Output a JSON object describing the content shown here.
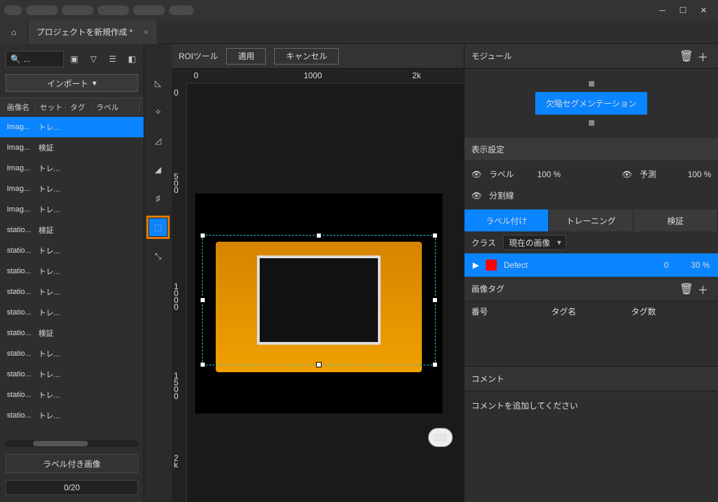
{
  "titlebar": {
    "tab_label": "プロジェクトを新規作成 *"
  },
  "left": {
    "search_placeholder": "...",
    "import_label": "インポート",
    "columns": {
      "c1": "画像名",
      "c2": "セット",
      "c3": "タグ",
      "c4": "ラベル"
    },
    "rows": [
      {
        "name": "Imag...",
        "set": "トレ...",
        "sel": true
      },
      {
        "name": "Imag...",
        "set": "検証"
      },
      {
        "name": "Imag...",
        "set": "トレ..."
      },
      {
        "name": "Imag...",
        "set": "トレ..."
      },
      {
        "name": "Imag...",
        "set": "トレ..."
      },
      {
        "name": "statio...",
        "set": "検証"
      },
      {
        "name": "statio...",
        "set": "トレ..."
      },
      {
        "name": "statio...",
        "set": "トレ..."
      },
      {
        "name": "statio...",
        "set": "トレ..."
      },
      {
        "name": "statio...",
        "set": "トレ..."
      },
      {
        "name": "statio...",
        "set": "検証"
      },
      {
        "name": "statio...",
        "set": "トレ..."
      },
      {
        "name": "statio...",
        "set": "トレ..."
      },
      {
        "name": "statio...",
        "set": "トレ..."
      },
      {
        "name": "statio...",
        "set": "トレ..."
      }
    ],
    "labeled_images": "ラベル付き画像",
    "progress": "0/20"
  },
  "canvas": {
    "roi_title": "ROIツール",
    "apply": "適用",
    "cancel": "キャンセル",
    "ruler_h": {
      "0": "0",
      "1000": "1000",
      "2k": "2k"
    },
    "ruler_v": {
      "0": "0",
      "500": "5 0 0",
      "1000": "1 0 0 0",
      "1500": "1 5 0 0",
      "2k": "2 k"
    }
  },
  "right": {
    "module_title": "モジュール",
    "module_name": "欠陥セグメンテーション",
    "display_title": "表示設定",
    "label_lbl": "ラベル",
    "label_pct": "100 %",
    "pred_lbl": "予測",
    "pred_pct": "100 %",
    "seg_lbl": "分割線",
    "tabs": {
      "labeling": "ラベル付け",
      "training": "トレーニング",
      "validation": "検証"
    },
    "class_lbl": "クラス",
    "class_combo": "現在の画像",
    "class_row": {
      "name": "Defect",
      "count": "0",
      "pct": "30 %"
    },
    "tags_title": "画像タグ",
    "tag_cols": {
      "num": "番号",
      "name": "タグ名",
      "count": "タグ数"
    },
    "comment_title": "コメント",
    "comment_placeholder": "コメントを追加してください"
  }
}
